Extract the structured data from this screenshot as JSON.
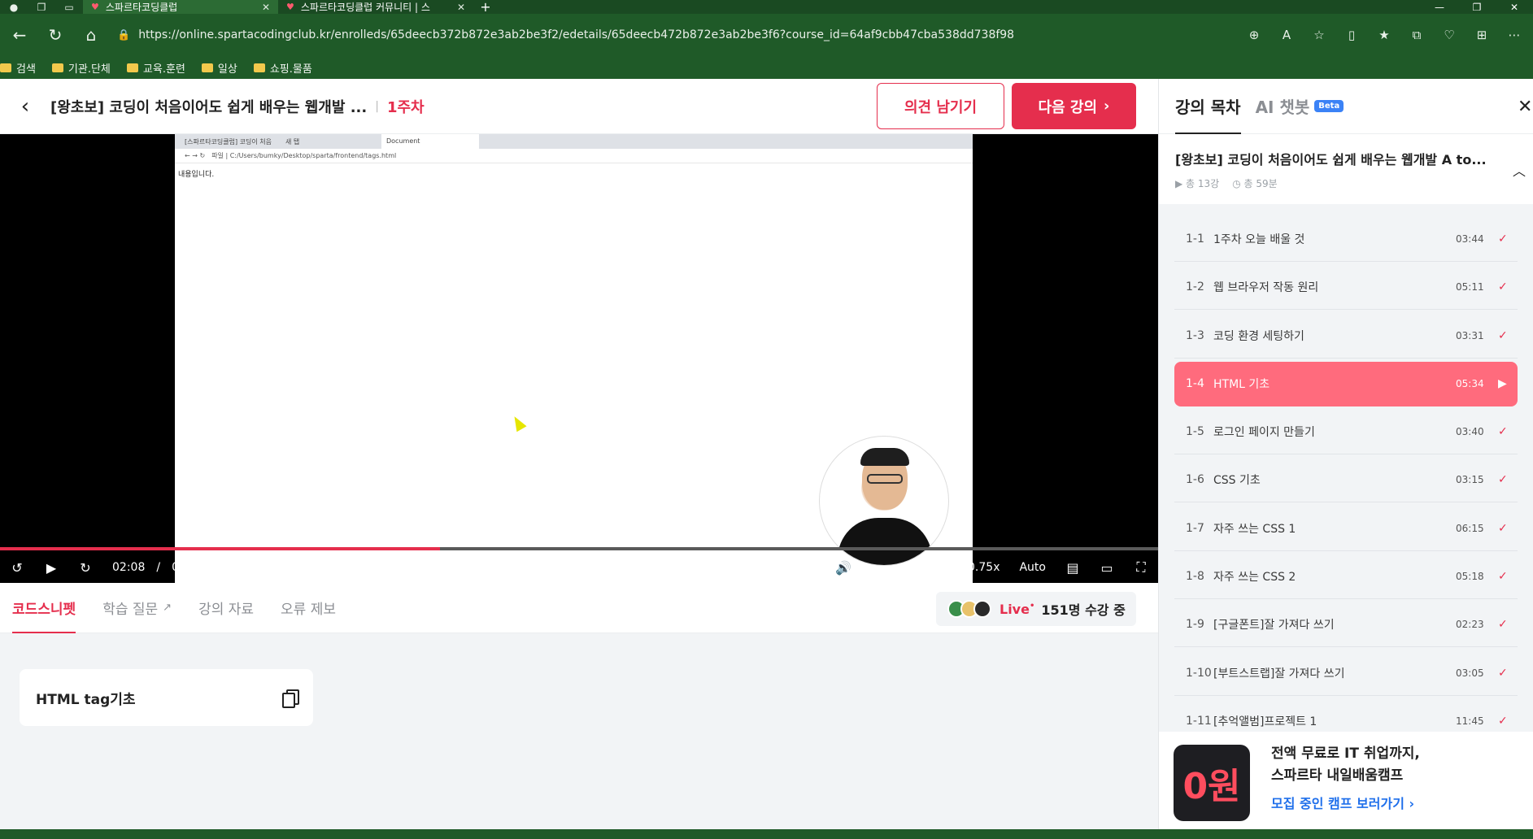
{
  "browser": {
    "tabs": [
      {
        "title": "스파르타코딩클럽",
        "active": true
      },
      {
        "title": "스파르타코딩클럽 커뮤니티 | 스",
        "active": false
      }
    ],
    "url": "https://online.spartacodingclub.kr/enrolleds/65deecb372b872e3ab2be3f2/edetails/65deecb472b872e3ab2be3f6?course_id=64af9cbb47cba538dd738f98",
    "bookmarks": [
      "검색",
      "기관.단체",
      "교육.훈련",
      "일상",
      "쇼핑.물품"
    ]
  },
  "header": {
    "course_title": "[왕초보] 코딩이 처음이어도 쉽게 배우는 웹개발 ...",
    "separator": "|",
    "week": "1주차",
    "feedback_label": "의견 남기기",
    "next_label": "다음 강의",
    "next_icon": "›"
  },
  "video": {
    "inner_tabs": [
      "[스파르타코딩클럽] 코딩이 처음",
      "새 탭",
      "Document"
    ],
    "inner_address": "파일 | C:/Users/bumky/Desktop/sparta/frontend/tags.html",
    "inner_content": "내용입니다.",
    "current_time": "02:08",
    "time_separator": "/",
    "duration": "05:34",
    "progress": 0.38,
    "speed": "0.75x",
    "quality": "Auto",
    "volume": 0.8
  },
  "subnav": {
    "tabs": [
      "코드스니펫",
      "학습 질문",
      "강의 자료",
      "오류 제보"
    ],
    "live_label": "Live",
    "live_dot": "•",
    "live_count": "151명 수강 중"
  },
  "snippet": {
    "title": "HTML tag기초"
  },
  "sidebar": {
    "tab_toc": "강의 목차",
    "tab_ai": "AI 챗봇",
    "beta": "Beta",
    "course_name": "[왕초보] 코딩이 처음이어도 쉽게 배우는 웹개발 A to...",
    "total_lessons": "총 13강",
    "total_time": "총 59분",
    "lessons": [
      {
        "num": "1-1",
        "title": "1주차 오늘 배울 것",
        "duration": "03:44",
        "status": "done"
      },
      {
        "num": "1-2",
        "title": "웹 브라우저 작동 원리",
        "duration": "05:11",
        "status": "done"
      },
      {
        "num": "1-3",
        "title": "코딩 환경 세팅하기",
        "duration": "03:31",
        "status": "done"
      },
      {
        "num": "1-4",
        "title": "HTML 기초",
        "duration": "05:34",
        "status": "playing"
      },
      {
        "num": "1-5",
        "title": "로그인 페이지 만들기",
        "duration": "03:40",
        "status": "done"
      },
      {
        "num": "1-6",
        "title": "CSS 기초",
        "duration": "03:15",
        "status": "done"
      },
      {
        "num": "1-7",
        "title": "자주 쓰는 CSS 1",
        "duration": "06:15",
        "status": "done"
      },
      {
        "num": "1-8",
        "title": "자주 쓰는 CSS 2",
        "duration": "05:18",
        "status": "done"
      },
      {
        "num": "1-9",
        "title": "[구글폰트]잘 가져다 쓰기",
        "duration": "02:23",
        "status": "done"
      },
      {
        "num": "1-10",
        "title": "[부트스트랩]잘 가져다 쓰기",
        "duration": "03:05",
        "status": "done"
      },
      {
        "num": "1-11",
        "title": "[추억앨범]프로젝트 1",
        "duration": "11:45",
        "status": "done"
      }
    ],
    "promo": {
      "logo": "0원",
      "line1": "전액 무료로 IT 취업까지,",
      "line2": "스파르타 내일배움캠프",
      "link": "모집 중인 캠프 보러가기 ›"
    }
  },
  "colors": {
    "brand": "#e52e4d",
    "active_lesson": "#ff6b7d",
    "chrome": "#1f5a28"
  }
}
